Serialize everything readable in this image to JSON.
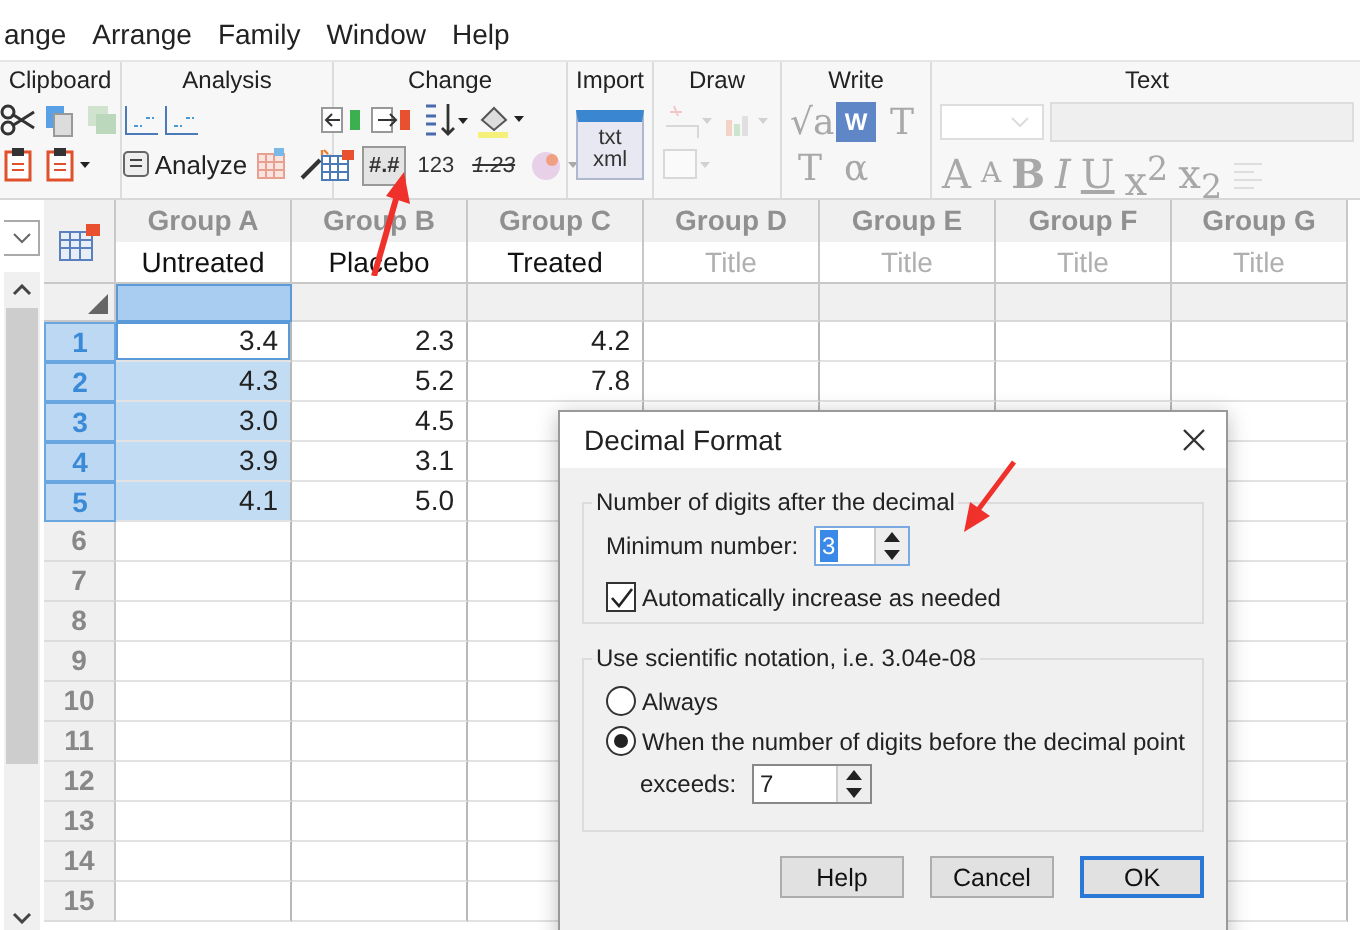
{
  "menu": [
    "ange",
    "Arrange",
    "Family",
    "Window",
    "Help"
  ],
  "ribbon": [
    {
      "kind": "clipboard",
      "label": "Clipboard",
      "disabled": false
    },
    {
      "kind": "analysis",
      "label": "Analysis",
      "button": "Analyze",
      "disabled": false
    },
    {
      "kind": "change",
      "label": "Change",
      "disabled": false,
      "tools": [
        {
          "text": "#.#",
          "selected": true
        },
        {
          "text": "123",
          "selected": false
        },
        {
          "text": "1.23",
          "selected": false
        }
      ]
    },
    {
      "kind": "import",
      "label": "Import",
      "disabled": false,
      "glyph": "txt xml"
    },
    {
      "kind": "draw",
      "label": "Draw",
      "disabled": true
    },
    {
      "kind": "write",
      "label": "Write",
      "disabled": true,
      "glyphs": [
        "√a",
        "W",
        "T",
        "T",
        "α"
      ]
    },
    {
      "kind": "text",
      "label": "Text",
      "disabled": true,
      "glyphs": [
        "A",
        "A",
        "B",
        "I",
        "U",
        "x$^{2}$",
        "x$_{2}$"
      ]
    }
  ],
  "table": {
    "columns": [
      {
        "group": "Group A",
        "title": "Untreated",
        "title_placeholder": false,
        "selected": true
      },
      {
        "group": "Group B",
        "title": "Placebo",
        "title_placeholder": false,
        "selected": false
      },
      {
        "group": "Group C",
        "title": "Treated",
        "title_placeholder": false,
        "selected": false
      },
      {
        "group": "Group D",
        "title": "Title",
        "title_placeholder": true,
        "selected": false
      },
      {
        "group": "Group E",
        "title": "Title",
        "title_placeholder": true,
        "selected": false
      },
      {
        "group": "Group F",
        "title": "Title",
        "title_placeholder": true,
        "selected": false
      },
      {
        "group": "Group G",
        "title": "Title",
        "title_placeholder": true,
        "selected": false
      }
    ],
    "rows": [
      {
        "number": "1",
        "selected": true,
        "active": true,
        "cells": [
          "3.4",
          "2.3",
          "4.2"
        ]
      },
      {
        "number": "2",
        "selected": true,
        "active": false,
        "cells": [
          "4.3",
          "5.2",
          "7.8"
        ]
      },
      {
        "number": "3",
        "selected": true,
        "active": false,
        "cells": [
          "3.0",
          "4.5"
        ]
      },
      {
        "number": "4",
        "selected": true,
        "active": false,
        "cells": [
          "3.9",
          "3.1"
        ]
      },
      {
        "number": "5",
        "selected": true,
        "active": false,
        "cells": [
          "4.1",
          "5.0"
        ]
      },
      {
        "number": "6",
        "selected": false,
        "active": false,
        "cells": []
      },
      {
        "number": "7",
        "selected": false,
        "active": false,
        "cells": []
      },
      {
        "number": "8",
        "selected": false,
        "active": false,
        "cells": []
      },
      {
        "number": "9",
        "selected": false,
        "active": false,
        "cells": []
      },
      {
        "number": "10",
        "selected": false,
        "active": false,
        "cells": []
      },
      {
        "number": "11",
        "selected": false,
        "active": false,
        "cells": []
      },
      {
        "number": "12",
        "selected": false,
        "active": false,
        "cells": []
      },
      {
        "number": "13",
        "selected": false,
        "active": false,
        "cells": []
      },
      {
        "number": "14",
        "selected": false,
        "active": false,
        "cells": []
      },
      {
        "number": "15",
        "selected": false,
        "active": false,
        "cells": []
      }
    ]
  },
  "dialog": {
    "title": "Decimal Format",
    "digits_group": {
      "label": "Number of digits after the decimal",
      "min_label": "Minimum number:",
      "min_value": "3",
      "auto_increase": {
        "label": "Automatically increase as needed",
        "checked": true
      }
    },
    "sci_group": {
      "label": "Use scientific notation,  i.e. 3.04e-08",
      "options": [
        {
          "label": "Always",
          "selected": false
        },
        {
          "label": "When the number of digits before the decimal point",
          "selected": true
        }
      ],
      "exceeds_label": "exceeds:",
      "exceeds_value": "7"
    },
    "buttons": [
      {
        "label": "Help",
        "default": false
      },
      {
        "label": "Cancel",
        "default": false
      },
      {
        "label": "OK",
        "default": true
      }
    ]
  }
}
